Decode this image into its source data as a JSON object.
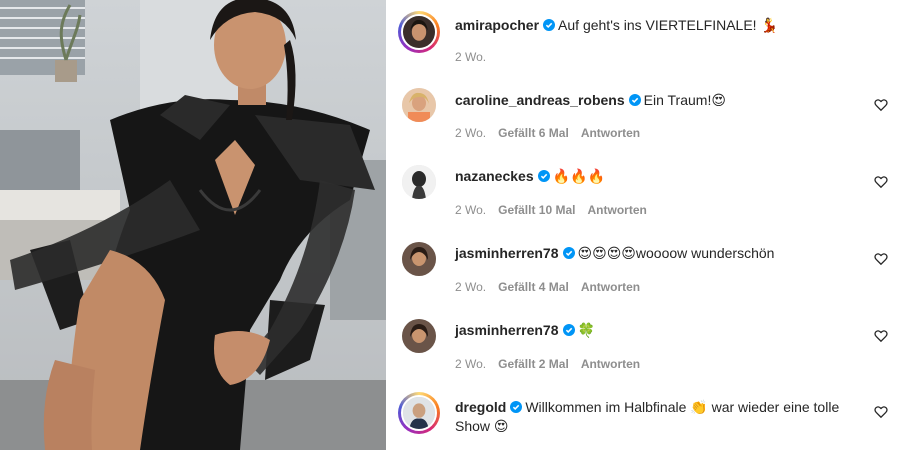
{
  "post": {
    "username": "amirapocher",
    "caption": "Auf geht's ins VIERTELFINALE! ",
    "caption_emoji": "💃",
    "time": "2 Wo."
  },
  "comments": [
    {
      "username": "caroline_andreas_robens",
      "text": "Ein Traum!",
      "emoji": "😍",
      "time": "2 Wo.",
      "likes": "Gefällt 6 Mal",
      "reply": "Antworten"
    },
    {
      "username": "nazaneckes",
      "text": "",
      "emoji": "🔥🔥🔥",
      "time": "2 Wo.",
      "likes": "Gefällt 10 Mal",
      "reply": "Antworten"
    },
    {
      "username": "jasminherren78",
      "text": "woooow wunderschön",
      "emoji": "😍😍😍😍",
      "time": "2 Wo.",
      "likes": "Gefällt 4 Mal",
      "reply": "Antworten"
    },
    {
      "username": "jasminherren78",
      "text": "",
      "emoji": "🍀",
      "time": "2 Wo.",
      "likes": "Gefällt 2 Mal",
      "reply": "Antworten"
    },
    {
      "username": "dregold",
      "text_a": "Willkommen im Halbfinale ",
      "emoji_a": "👏",
      "text_b": " war wieder eine tolle Show ",
      "emoji_b": "😍"
    }
  ],
  "icons": {
    "verified": "verified-badge-icon",
    "like": "heart-outline-icon"
  },
  "colors": {
    "verified": "#0095f6",
    "meta": "#8e8e8e",
    "text": "#262626"
  }
}
